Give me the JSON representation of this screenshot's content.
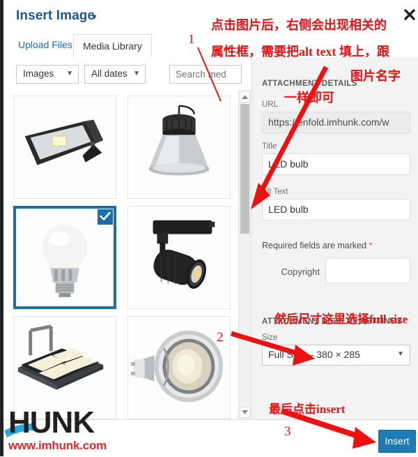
{
  "modal": {
    "title": "Insert Image",
    "title_caret": "▼",
    "close_icon": "close-icon"
  },
  "tabs": [
    {
      "label": "Upload Files",
      "active": false
    },
    {
      "label": "Media Library",
      "active": true
    }
  ],
  "filters": {
    "type": {
      "value": "Images",
      "caret": "▼"
    },
    "date": {
      "value": "All dates",
      "caret": "▼"
    },
    "search": {
      "value": "",
      "placeholder": "Search med"
    }
  },
  "grid": {
    "items": [
      {
        "name": "LED flood light",
        "selected": false
      },
      {
        "name": "LED high bay light",
        "selected": false
      },
      {
        "name": "LED bulb",
        "selected": true,
        "check": "✔"
      },
      {
        "name": "LED track light",
        "selected": false
      },
      {
        "name": "LED tunnel light module",
        "selected": false
      },
      {
        "name": "LED GU10 spotlight",
        "selected": false
      }
    ]
  },
  "scrollbar": {
    "up_arrow": "chevron-up-icon",
    "down_arrow": "chevron-down-icon"
  },
  "details": {
    "heading": "ATTACHMENT DETAILS",
    "url": {
      "label": "URL",
      "value": "https://enfold.imhunk.com/w"
    },
    "title": {
      "label": "Title",
      "value": "LED bulb"
    },
    "alt": {
      "label": "Alt Text",
      "value": "LED bulb"
    },
    "required_note": "Required fields are marked",
    "required_star": "*",
    "copyright": {
      "label": "Copyright",
      "value": ""
    }
  },
  "display_settings": {
    "heading": "ATTACHMENT DISPLAY SETTINGS",
    "size": {
      "label": "Size",
      "value": "Full Size – 380 × 285",
      "caret": "▼"
    }
  },
  "footer": {
    "insert_label": "Insert"
  },
  "annotations": {
    "line1": "点击图片后，右侧会出现相关的",
    "line2": "属性框，需要把alt text 填上，跟",
    "line3": "图片名字",
    "line4": "一样即可",
    "line5": "然后尺寸这里选择full size",
    "line6": "最后点击insert",
    "num1": "1",
    "num2": "2",
    "num3": "3",
    "color": "#ee1111"
  },
  "watermark": {
    "brand": "HUNK",
    "url": "www.imhunk.com",
    "brand_color": "#231f20",
    "url_color": "#e8262d",
    "swoosh_color": "#29abe2"
  }
}
